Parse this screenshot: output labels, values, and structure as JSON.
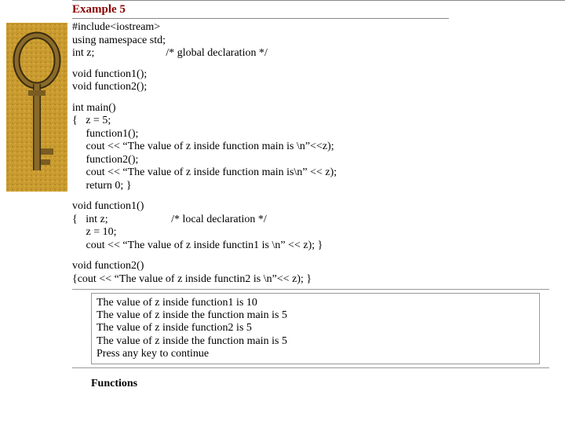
{
  "title": "Example 5",
  "code": {
    "l1": "#include<iostream>",
    "l2": "using namespace std;",
    "l3a": "int z;",
    "l3b": "/* global declaration */",
    "l4": "void function1();",
    "l5": "void function2();",
    "l6": "int main()",
    "l7": "{   z = 5;",
    "l8": "     function1();",
    "l9": "     cout << “The value of z inside function main is \\n”<<z);",
    "l10": "     function2();",
    "l11": "     cout << “The value of z inside function main is\\n” << z);",
    "l12": "     return 0; }",
    "l13": "void function1()",
    "l14a": "{   int z;",
    "l14b": "/* local declaration */",
    "l15": "     z = 10;",
    "l16": "     cout << “The value of z inside functin1 is \\n” << z); }",
    "l17": "void function2()",
    "l18": "{cout << “The value of z inside functin2 is \\n”<< z); }"
  },
  "output": {
    "o1": "The value of z inside function1 is 10",
    "o2": "The value of z inside the function main is 5",
    "o3": "The value of z inside function2 is 5",
    "o4": "The value of z inside the function main is 5",
    "o5": "Press any key to continue"
  },
  "footer": "Functions"
}
